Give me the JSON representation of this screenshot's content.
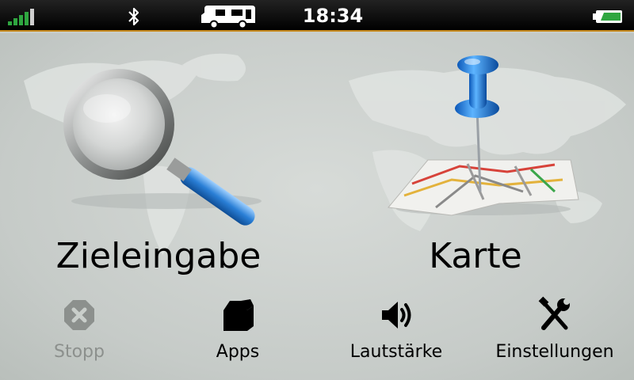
{
  "status_bar": {
    "time": "18:34",
    "signal_bars_active": 4,
    "signal_bars_total": 5,
    "icons": [
      "signal-icon",
      "bluetooth-icon",
      "camper-icon",
      "battery-icon"
    ],
    "colors": {
      "signal": "#2fa640",
      "battery": "#2fa640",
      "accent_line": "#c88a1e"
    }
  },
  "main": {
    "tiles": [
      {
        "label": "Zieleingabe",
        "icon": "magnifier-icon"
      },
      {
        "label": "Karte",
        "icon": "map-pin-icon"
      }
    ]
  },
  "bottom": {
    "buttons": [
      {
        "label": "Stopp",
        "icon": "stop-icon",
        "enabled": false
      },
      {
        "label": "Apps",
        "icon": "apps-box-icon",
        "enabled": true
      },
      {
        "label": "Lautstärke",
        "icon": "volume-icon",
        "enabled": true
      },
      {
        "label": "Einstellungen",
        "icon": "settings-tools-icon",
        "enabled": true
      }
    ]
  }
}
